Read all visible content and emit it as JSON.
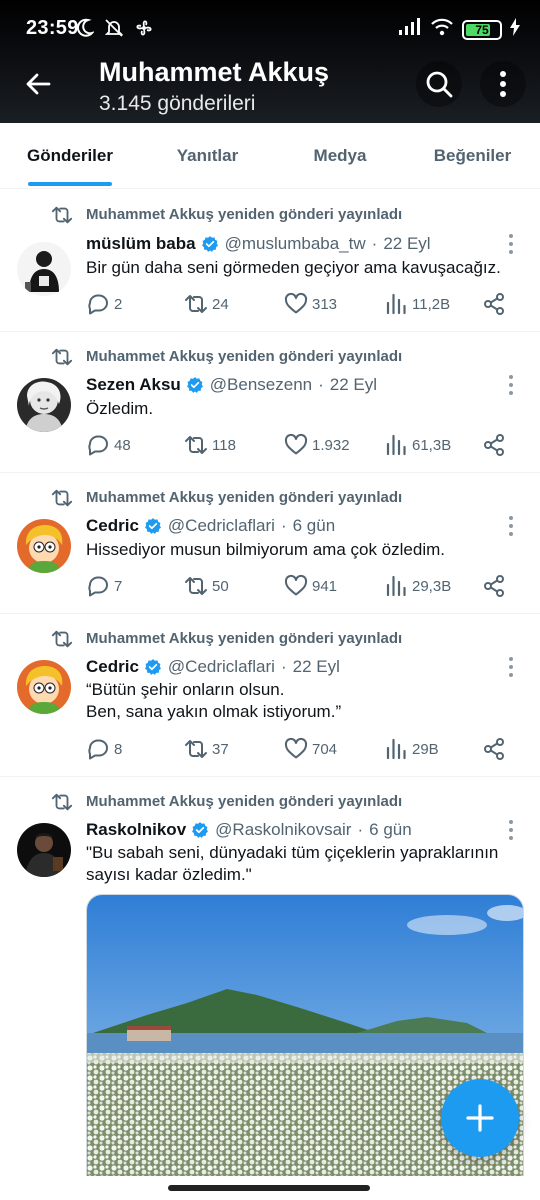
{
  "status_bar": {
    "time": "23:59",
    "battery": "75"
  },
  "header": {
    "title": "Muhammet Akkuş",
    "subtitle": "3.145 gönderileri"
  },
  "tabs": [
    {
      "label": "Gönderiler",
      "active": true
    },
    {
      "label": "Yanıtlar",
      "active": false
    },
    {
      "label": "Medya",
      "active": false
    },
    {
      "label": "Beğeniler",
      "active": false
    }
  ],
  "posts": [
    {
      "repost_text": "Muhammet Akkuş yeniden gönderi yayınladı",
      "name": "müslüm baba",
      "handle": "@muslumbaba_tw",
      "time": "22 Eyl",
      "lines": [
        "Bir gün daha seni görmeden geçiyor ama kavuşacağız."
      ],
      "replies": "2",
      "reposts": "24",
      "likes": "313",
      "views": "11,2B"
    },
    {
      "repost_text": "Muhammet Akkuş yeniden gönderi yayınladı",
      "name": "Sezen Aksu",
      "handle": "@Bensezenn",
      "time": "22 Eyl",
      "lines": [
        "Özledim."
      ],
      "replies": "48",
      "reposts": "118",
      "likes": "1.932",
      "views": "61,3B"
    },
    {
      "repost_text": "Muhammet Akkuş yeniden gönderi yayınladı",
      "name": "Cedric",
      "handle": "@Cedriclaflari",
      "time": "6 gün",
      "lines": [
        "Hissediyor musun bilmiyorum ama çok özledim."
      ],
      "replies": "7",
      "reposts": "50",
      "likes": "941",
      "views": "29,3B"
    },
    {
      "repost_text": "Muhammet Akkuş yeniden gönderi yayınladı",
      "name": "Cedric",
      "handle": "@Cedriclaflari",
      "time": "22 Eyl",
      "lines": [
        "“Bütün şehir onların olsun.",
        "Ben, sana yakın olmak istiyorum.”"
      ],
      "replies": "8",
      "reposts": "37",
      "likes": "704",
      "views": "29B"
    },
    {
      "repost_text": "Muhammet Akkuş yeniden gönderi yayınladı",
      "name": "Raskolnikov",
      "handle": "@Raskolnikovsair",
      "time": "6 gün",
      "lines": [
        "\"Bu sabah seni, dünyadaki tüm çiçeklerin yapraklarının",
        "sayısı kadar özledim.\""
      ]
    }
  ],
  "colors": {
    "accent": "#1d9bf0",
    "secondary_text": "#536471",
    "verified": "#1d9bf0"
  }
}
